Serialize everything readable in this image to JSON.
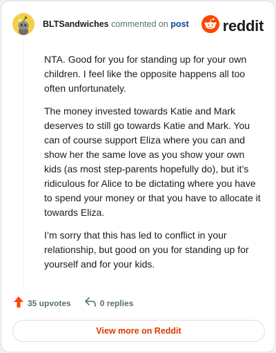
{
  "comment": {
    "author": "BLTSandwiches",
    "commented_on": "commented on",
    "post_link": "post",
    "paragraphs": [
      "NTA. Good for you for standing up for your own children. I feel like the opposite happens all too often unfortunately.",
      "The money invested towards Katie and Mark deserves to still go towards Katie and Mark. You can of course support Eliza where you can and show her the same love as you show your own kids (as most step-parents hopefully do), but it’s ridiculous for Alice to be dictating where you have to spend your money or that you have to allocate it towards Eliza.",
      "I’m sorry that this has led to conflict in your relationship, but good on you for standing up for yourself and for your kids."
    ]
  },
  "brand": {
    "wordmark": "reddit",
    "accent_color": "#ff4500"
  },
  "actions": {
    "upvotes": "35 upvotes",
    "replies": "0 replies"
  },
  "cta": {
    "label": "View more on Reddit"
  },
  "icons": {
    "avatar": "snoo-avatar-icon",
    "logo": "reddit-logo-icon",
    "upvote": "upvote-arrow-icon",
    "reply": "reply-arrow-icon"
  }
}
